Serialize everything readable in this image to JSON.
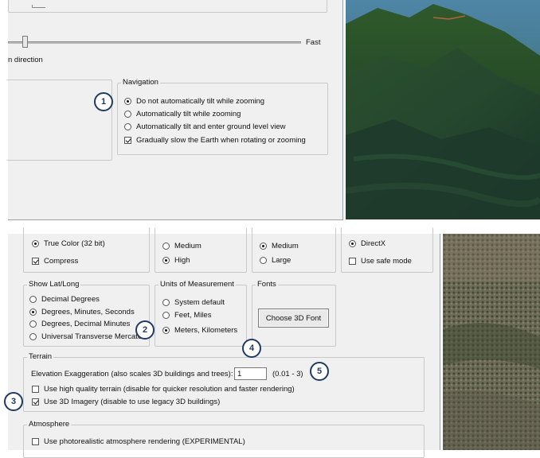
{
  "top": {
    "slider_fast_label": "Fast",
    "direction_label": "n direction",
    "navigation": {
      "legend": "Navigation",
      "options": [
        {
          "label": "Do not automatically tilt while zooming",
          "type": "radio",
          "checked": true
        },
        {
          "label": "Automatically tilt while zooming",
          "type": "radio",
          "checked": false
        },
        {
          "label": "Automatically tilt and enter ground level view",
          "type": "radio",
          "checked": false
        },
        {
          "label": "Gradually slow the Earth when rotating or zooming",
          "type": "checkbox",
          "checked": true
        }
      ]
    }
  },
  "bottom": {
    "color": {
      "true_color": "True Color (32 bit)",
      "compress": "Compress"
    },
    "quality1": {
      "medium": "Medium",
      "high": "High"
    },
    "quality2": {
      "medium": "Medium",
      "large": "Large"
    },
    "graphics": {
      "directx": "DirectX",
      "safe_mode": "Use safe mode"
    },
    "latlong": {
      "legend": "Show Lat/Long",
      "options": [
        "Decimal Degrees",
        "Degrees, Minutes, Seconds",
        "Degrees, Decimal Minutes",
        "Universal Transverse Mercator"
      ],
      "selected": 1
    },
    "units": {
      "legend": "Units of Measurement",
      "options": [
        "System default",
        "Feet, Miles",
        "Meters, Kilometers"
      ],
      "selected": 2
    },
    "fonts": {
      "legend": "Fonts",
      "button": "Choose 3D Font"
    },
    "terrain": {
      "legend": "Terrain",
      "elevation_label": "Elevation Exaggeration (also scales 3D buildings and trees):",
      "elevation_value": "1",
      "elevation_range": "(0.01 - 3)",
      "high_quality": "Use high quality terrain (disable for quicker resolution and faster rendering)",
      "use_3d_imagery": "Use 3D Imagery (disable to use legacy 3D buildings)"
    },
    "atmosphere": {
      "legend": "Atmosphere",
      "photorealistic": "Use photorealistic atmosphere rendering (EXPERIMENTAL)"
    }
  },
  "callouts": [
    "1",
    "2",
    "3",
    "4",
    "5"
  ]
}
